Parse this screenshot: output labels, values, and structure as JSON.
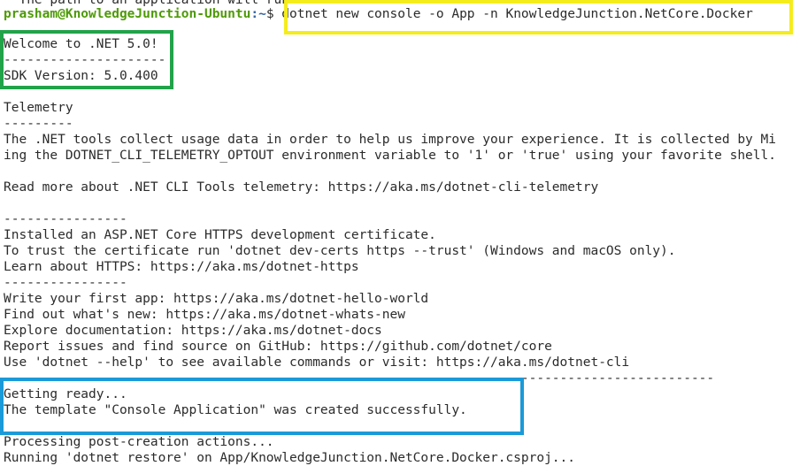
{
  "terminal": {
    "prompt": {
      "user_host": "prasham@KnowledgeJunction-Ubuntu",
      "path": ":~",
      "symbol": "$ ",
      "command": "dotnet new console -o App -n KnowledgeJunction.NetCore.Docker"
    },
    "lines": [
      "  The path to an application will run. An Automate",
      "Welcome to .NET 5.0!",
      "---------------------",
      "SDK Version: 5.0.400",
      "",
      "Telemetry",
      "---------",
      "The .NET tools collect usage data in order to help us improve your experience. It is collected by Mi",
      "ing the DOTNET_CLI_TELEMETRY_OPTOUT environment variable to '1' or 'true' using your favorite shell.",
      "",
      "Read more about .NET CLI Tools telemetry: https://aka.ms/dotnet-cli-telemetry",
      "",
      "----------------",
      "Installed an ASP.NET Core HTTPS development certificate.",
      "To trust the certificate run 'dotnet dev-certs https --trust' (Windows and macOS only).",
      "Learn about HTTPS: https://aka.ms/dotnet-https",
      "----------------",
      "Write your first app: https://aka.ms/dotnet-hello-world",
      "Find out what's new: https://aka.ms/dotnet-whats-new",
      "Explore documentation: https://aka.ms/dotnet-docs",
      "Report issues and find source on GitHub: https://github.com/dotnet/core",
      "Use 'dotnet --help' to see available commands or visit: https://aka.ms/dotnet-cli",
      "--------------------------------------------------------------------------------------------",
      "Getting ready...",
      "The template \"Console Application\" was created successfully.",
      "",
      "Processing post-creation actions...",
      "Running 'dotnet restore' on App/KnowledgeJunction.NetCore.Docker.csproj..."
    ]
  },
  "highlights": {
    "command_box_color": "#f5ec1c",
    "welcome_box_color": "#22a34a",
    "template_box_color": "#1a9ad8"
  }
}
